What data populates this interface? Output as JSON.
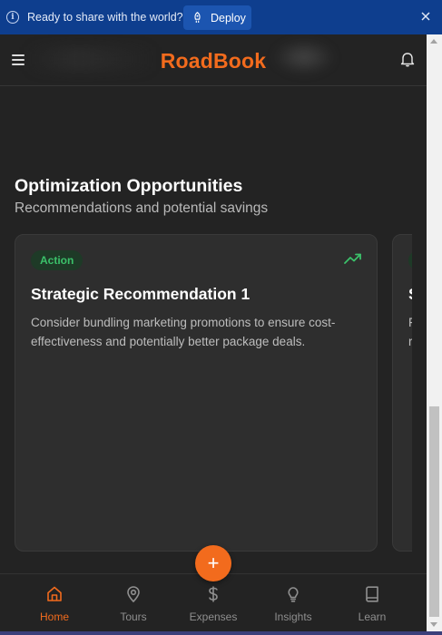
{
  "banner": {
    "message": "Ready to share with the world?",
    "deploy_label": "Deploy",
    "icons": [
      "info-icon",
      "rocket-icon",
      "close-icon"
    ]
  },
  "header": {
    "brand": "RoadBook",
    "brand_color": "#f26b1d",
    "icons": [
      "hamburger-menu-icon",
      "bell-icon"
    ]
  },
  "section": {
    "title": "Optimization Opportunities",
    "subtitle": "Recommendations and potential savings"
  },
  "cards": [
    {
      "badge": "Action",
      "badge_color": "#3bc16a",
      "title": "Strategic Recommendation 1",
      "description": "Consider bundling marketing promotions to ensure cost-effectiveness and potentially better package deals.",
      "icon": "trending-up-icon"
    },
    {
      "title_partial": "S",
      "desc_partial": [
        "F",
        "r"
      ]
    }
  ],
  "fab": {
    "label": "+"
  },
  "nav": {
    "items": [
      {
        "label": "Home",
        "icon": "home-icon",
        "active": true
      },
      {
        "label": "Tours",
        "icon": "map-pin-icon",
        "active": false
      },
      {
        "label": "Expenses",
        "icon": "dollar-icon",
        "active": false
      },
      {
        "label": "Insights",
        "icon": "lightbulb-icon",
        "active": false
      },
      {
        "label": "Learn",
        "icon": "book-icon",
        "active": false
      }
    ]
  }
}
